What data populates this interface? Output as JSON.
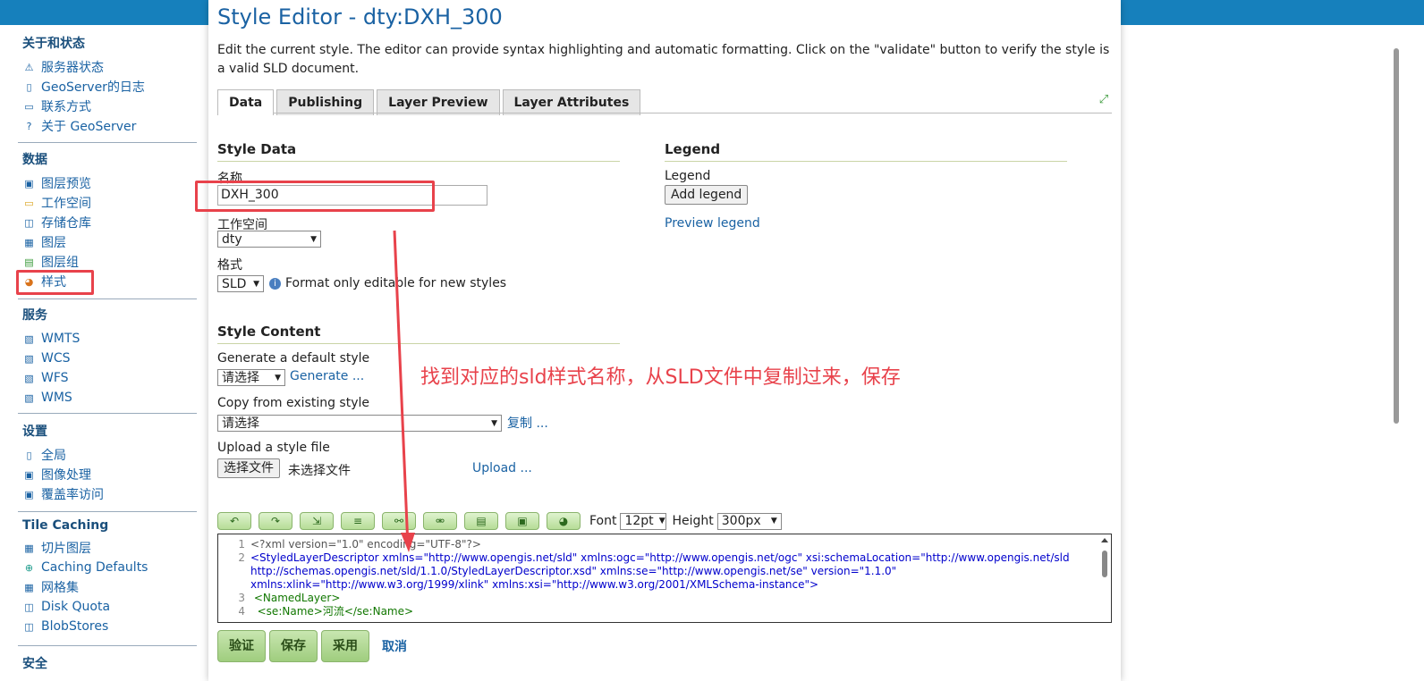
{
  "sidebar": {
    "sections": [
      {
        "title": "关于和状态",
        "items": [
          {
            "label": "服务器状态",
            "icon": "server-status-icon"
          },
          {
            "label": "GeoServer的日志",
            "icon": "log-icon"
          },
          {
            "label": "联系方式",
            "icon": "contact-icon"
          },
          {
            "label": "关于 GeoServer",
            "icon": "help-icon"
          }
        ]
      },
      {
        "title": "数据",
        "items": [
          {
            "label": "图层预览",
            "icon": "layer-preview-icon"
          },
          {
            "label": "工作空间",
            "icon": "folder-icon"
          },
          {
            "label": "存储仓库",
            "icon": "store-icon"
          },
          {
            "label": "图层",
            "icon": "layer-icon"
          },
          {
            "label": "图层组",
            "icon": "layer-group-icon"
          },
          {
            "label": "样式",
            "icon": "palette-icon"
          }
        ]
      },
      {
        "title": "服务",
        "items": [
          {
            "label": "WMTS",
            "icon": "service-icon"
          },
          {
            "label": "WCS",
            "icon": "service-icon"
          },
          {
            "label": "WFS",
            "icon": "service-icon"
          },
          {
            "label": "WMS",
            "icon": "service-icon"
          }
        ]
      },
      {
        "title": "设置",
        "items": [
          {
            "label": "全局",
            "icon": "global-icon"
          },
          {
            "label": "图像处理",
            "icon": "image-icon"
          },
          {
            "label": "覆盖率访问",
            "icon": "coverage-icon"
          }
        ]
      },
      {
        "title": "Tile Caching",
        "items": [
          {
            "label": "切片图层",
            "icon": "tile-icon"
          },
          {
            "label": "Caching Defaults",
            "icon": "globe-icon"
          },
          {
            "label": "网格集",
            "icon": "grid-icon"
          },
          {
            "label": "Disk Quota",
            "icon": "disk-icon"
          },
          {
            "label": "BlobStores",
            "icon": "store-icon"
          }
        ]
      },
      {
        "title": "安全",
        "items": []
      }
    ]
  },
  "page": {
    "title": "Style Editor - dty:DXH_300",
    "description": "Edit the current style. The editor can provide syntax highlighting and automatic formatting. Click on the \"validate\" button to verify the style is a valid SLD document."
  },
  "tabs": [
    "Data",
    "Publishing",
    "Layer Preview",
    "Layer Attributes"
  ],
  "style_data": {
    "heading": "Style Data",
    "name_label": "名称",
    "name_value": "DXH_300",
    "workspace_label": "工作空间",
    "workspace_value": "dty",
    "format_label": "格式",
    "format_value": "SLD",
    "format_note": "Format only editable for new styles"
  },
  "legend": {
    "heading": "Legend",
    "label": "Legend",
    "add_button": "Add legend",
    "preview_link": "Preview legend"
  },
  "style_content": {
    "heading": "Style Content",
    "generate_label": "Generate a default style",
    "generate_select": "请选择",
    "generate_link": "Generate ...",
    "copy_label": "Copy from existing style",
    "copy_select": "请选择",
    "copy_link": "复制 ...",
    "upload_label": "Upload a style file",
    "choose_file_button": "选择文件",
    "no_file_text": "未选择文件",
    "upload_link": "Upload ..."
  },
  "editor_toolbar": {
    "font_label": "Font",
    "font_value": "12pt",
    "height_label": "Height",
    "height_value": "300px"
  },
  "editor": {
    "lines": [
      {
        "n": "1",
        "text": "<?xml version=\"1.0\" encoding=\"UTF-8\"?>"
      },
      {
        "n": "2",
        "text": "<StyledLayerDescriptor xmlns=\"http://www.opengis.net/sld\" xmlns:ogc=\"http://www.opengis.net/ogc\" xsi:schemaLocation=\"http://www.opengis.net/sld"
      },
      {
        "n": "",
        "text": "http://schemas.opengis.net/sld/1.1.0/StyledLayerDescriptor.xsd\" xmlns:se=\"http://www.opengis.net/se\" version=\"1.1.0\""
      },
      {
        "n": "",
        "text": "xmlns:xlink=\"http://www.w3.org/1999/xlink\" xmlns:xsi=\"http://www.w3.org/2001/XMLSchema-instance\">"
      },
      {
        "n": "3",
        "text": " <NamedLayer>"
      },
      {
        "n": "4",
        "text": "  <se:Name>河流</se:Name>"
      }
    ]
  },
  "actions": {
    "validate": "验证",
    "save": "保存",
    "apply": "采用",
    "cancel": "取消"
  },
  "annotation": "找到对应的sld样式名称，从SLD文件中复制过来，保存",
  "colors": {
    "accent": "#1a62a3",
    "topbar": "#1680bc",
    "highlight": "#e8424b"
  }
}
